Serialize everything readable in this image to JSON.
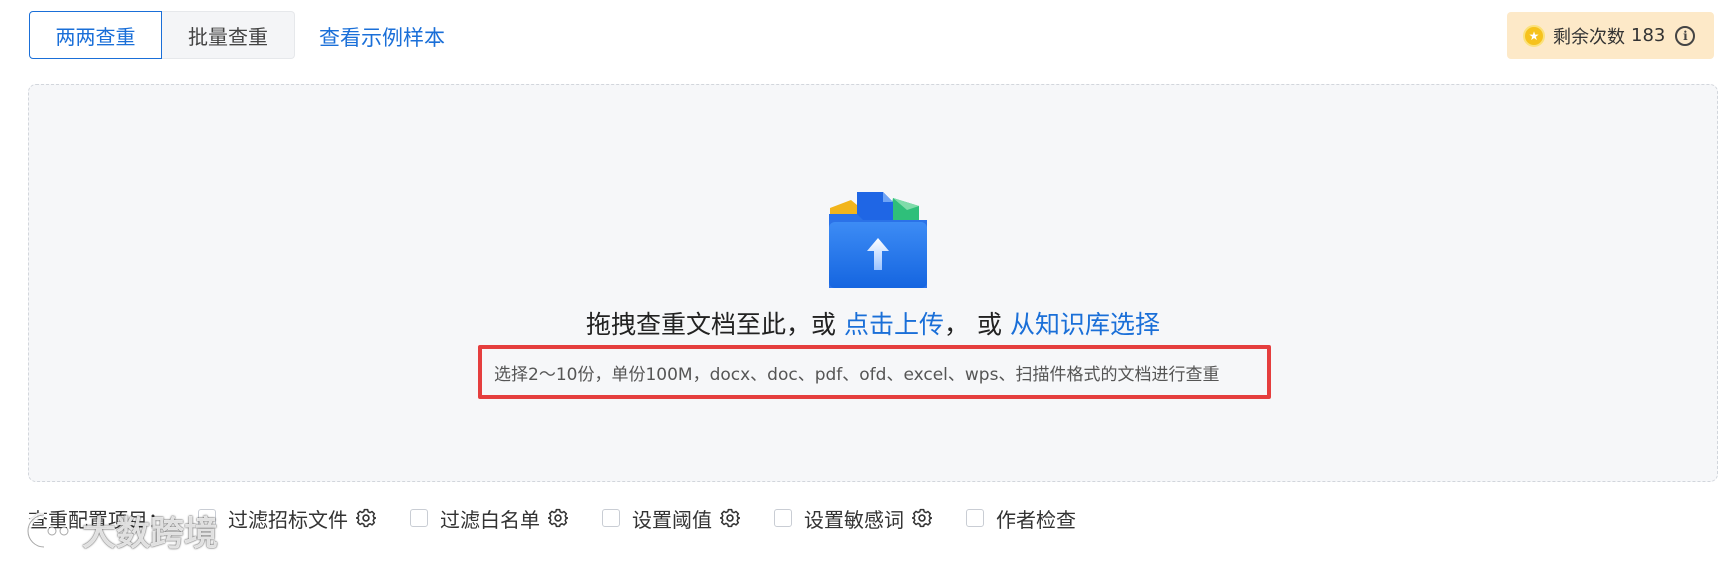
{
  "tabs": [
    {
      "label": "两两查重",
      "active": true
    },
    {
      "label": "批量查重",
      "active": false
    }
  ],
  "sample_link": "查看示例样本",
  "remaining": {
    "label": "剩余次数",
    "count": "183",
    "icon": "coin-icon",
    "info_icon": "info-icon"
  },
  "upload": {
    "icon": "folder-upload-icon",
    "text_prefix": "拖拽查重文档至此，或",
    "upload_link": "点击上传",
    "separator": "，  或",
    "kb_link": "从知识库选择",
    "hint": "选择2～10份，单份100M，docx、doc、pdf、ofd、excel、wps、扫描件格式的文档进行查重"
  },
  "config": {
    "label": "查重配置项目：",
    "options": [
      {
        "label": "过滤招标文件",
        "checked": false,
        "has_settings": true
      },
      {
        "label": "过滤白名单",
        "checked": false,
        "has_settings": true
      },
      {
        "label": "设置阈值",
        "checked": false,
        "has_settings": true
      },
      {
        "label": "设置敏感词",
        "checked": false,
        "has_settings": true
      },
      {
        "label": "作者检查",
        "checked": false,
        "has_settings": false
      }
    ]
  },
  "watermark": "大数跨境",
  "colors": {
    "accent": "#1a6fd8",
    "badge_bg": "#fde9c8",
    "highlight_border": "#e53e3e",
    "upload_bg": "#f6f7f9"
  }
}
